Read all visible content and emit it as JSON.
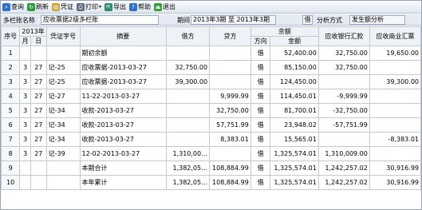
{
  "toolbar": {
    "buttons": [
      {
        "label": "查询",
        "icon": "search-icon",
        "color": "#2f6fc7",
        "glyph": "⌕"
      },
      {
        "label": "刷新",
        "icon": "refresh-icon",
        "color": "#2d9a3a",
        "glyph": "↻"
      },
      {
        "label": "凭证",
        "icon": "voucher-icon",
        "color": "#c8a23a",
        "glyph": "▤"
      },
      {
        "label": "打印",
        "icon": "print-icon",
        "color": "#5a6a80",
        "glyph": "⎙",
        "caret": "▾"
      },
      {
        "label": "导出",
        "icon": "export-icon",
        "color": "#2b8a6a",
        "glyph": "⇱"
      },
      {
        "label": "帮助",
        "icon": "help-icon",
        "color": "#2f6fc7",
        "glyph": "?"
      },
      {
        "label": "退出",
        "icon": "exit-icon",
        "color": "#3b9a3b",
        "glyph": "⏏"
      }
    ]
  },
  "filter": {
    "account_name_label": "多栏账名称",
    "account_name_value": "应收票据2级多栏账",
    "period_label": "期间",
    "period_value": "2013年3期  至  2013年3期",
    "direction_value": "借",
    "analysis_label": "分析方式",
    "analysis_value": "发生额分析"
  },
  "table": {
    "headers": {
      "seq": "序号",
      "year": "2013年",
      "month": "月",
      "day": "日",
      "voucher": "凭证字号",
      "summary": "摘要",
      "debit": "借方",
      "credit": "贷方",
      "balance": "余额",
      "direction": "方向",
      "amount": "金额",
      "bank_draft": "应收银行汇款",
      "commercial_draft": "应收商业汇票"
    },
    "rows": [
      {
        "seq": "1",
        "month": "",
        "day": "",
        "voucher": "",
        "summary": "期初余额",
        "debit": "",
        "credit": "",
        "direction": "借",
        "amount": "52,400.00",
        "bank": "32,750.00",
        "commercial": "19,650.00"
      },
      {
        "seq": "2",
        "month": "3",
        "day": "27",
        "voucher": "记-25",
        "summary": "应收票据-2013-03-27",
        "debit": "32,750.00",
        "credit": "",
        "direction": "借",
        "amount": "85,150.00",
        "bank": "32,750.00",
        "commercial": ""
      },
      {
        "seq": "3",
        "month": "3",
        "day": "27",
        "voucher": "记-25",
        "summary": "应收票据-2013-03-27",
        "debit": "39,300.00",
        "credit": "",
        "direction": "借",
        "amount": "124,450.00",
        "bank": "",
        "commercial": "39,300.00"
      },
      {
        "seq": "4",
        "month": "3",
        "day": "27",
        "voucher": "记-27",
        "summary": "11-22-2013-03-27",
        "debit": "",
        "credit": "9,999.99",
        "direction": "借",
        "amount": "114,450.01",
        "bank": "-9,999.99",
        "commercial": ""
      },
      {
        "seq": "5",
        "month": "3",
        "day": "27",
        "voucher": "记-34",
        "summary": "收款-2013-03-27",
        "debit": "",
        "credit": "32,750.00",
        "direction": "借",
        "amount": "81,700.01",
        "bank": "-32,750.00",
        "commercial": ""
      },
      {
        "seq": "6",
        "month": "3",
        "day": "27",
        "voucher": "记-34",
        "summary": "收款-2013-03-27",
        "debit": "",
        "credit": "57,751.99",
        "direction": "借",
        "amount": "23,948.02",
        "bank": "-57,751.99",
        "commercial": ""
      },
      {
        "seq": "7",
        "month": "3",
        "day": "27",
        "voucher": "记-34",
        "summary": "收款-2013-03-27",
        "debit": "",
        "credit": "8,383.01",
        "direction": "借",
        "amount": "15,565.01",
        "bank": "",
        "commercial": "-8,383.01"
      },
      {
        "seq": "8",
        "month": "3",
        "day": "27",
        "voucher": "记-39",
        "summary": "12-02-2013-03-27",
        "debit": "1,310,00…",
        "credit": "",
        "direction": "借",
        "amount": "1,325,574.01",
        "bank": "1,310,009.00",
        "commercial": ""
      },
      {
        "seq": "9",
        "month": "",
        "day": "",
        "voucher": "",
        "summary": "本期合计",
        "debit": "1,382,05…",
        "credit": "108,884.99",
        "direction": "借",
        "amount": "1,325,574.01",
        "bank": "1,242,257.02",
        "commercial": "30,916.99"
      },
      {
        "seq": "10",
        "month": "",
        "day": "",
        "voucher": "",
        "summary": "本年累计",
        "debit": "1,382,05…",
        "credit": "108,884.99",
        "direction": "借",
        "amount": "1,325,574.01",
        "bank": "1,242,257.02",
        "commercial": "30,916.99"
      }
    ]
  }
}
